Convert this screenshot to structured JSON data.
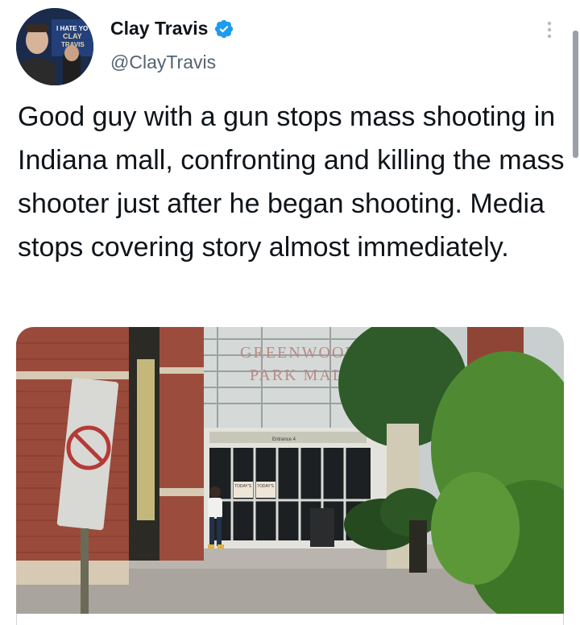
{
  "tweet": {
    "author_name": "Clay Travis",
    "author_handle": "@ClayTravis",
    "text": "Good guy with a gun stops mass shooting in Indiana mall, confronting and killing the mass shooter just after he began shooting. Media stops covering story almost immediately.",
    "avatar_sign": {
      "line1": "I HATE YO",
      "line2": "CLAY",
      "line3": "TRAVIS"
    }
  },
  "media": {
    "sign_line1": "GREENWOOD",
    "sign_line2": "PARK MALL",
    "entrance_label": "Entrance 4",
    "poster_left": "TODAY'S",
    "poster_right": "TODAY'S"
  },
  "colors": {
    "verified": "#1d9bf0",
    "text": "#0f1419",
    "secondary": "#536471"
  }
}
